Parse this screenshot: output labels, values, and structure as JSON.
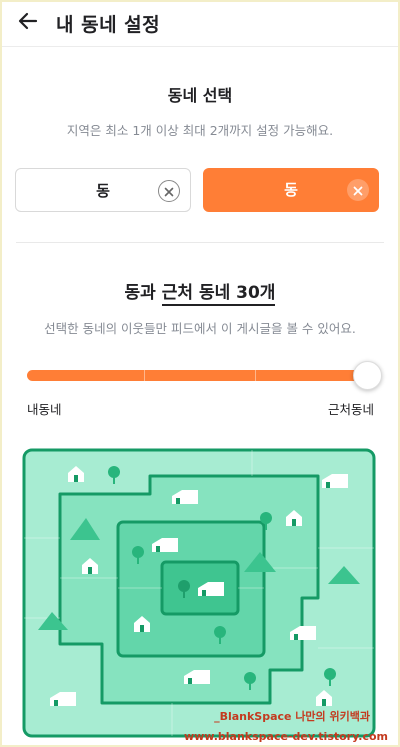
{
  "header": {
    "title": "내 동네 설정"
  },
  "section1": {
    "title": "동네 선택",
    "description": "지역은 최소 1개 이상 최대 2개까지 설정 가능해요."
  },
  "chips": [
    {
      "label": "동",
      "selected": false
    },
    {
      "label": "동",
      "selected": true
    }
  ],
  "section2": {
    "title_prefix": "동과 ",
    "title_underlined": "근처 동네 30개",
    "description": "선택한 동네의 이웃들만 피드에서 이 게시글을 볼 수 있어요."
  },
  "slider": {
    "min_label": "내동네",
    "max_label": "근처동네",
    "level_fraction": 1.0,
    "steps": 4
  },
  "icons": {
    "back": "arrow-left-icon",
    "clear": "close-icon"
  },
  "colors": {
    "accent": "#ff7e36",
    "map_outer": "#a7ecd2",
    "map_mid": "#82e2be",
    "map_inner": "#5fd4a8",
    "map_center": "#3cc48f",
    "map_border": "#159a65"
  },
  "watermark": {
    "line1": "_BlankSpace 나만의 위키백과",
    "line2": "www.blankspace-dev.tistory.com"
  }
}
